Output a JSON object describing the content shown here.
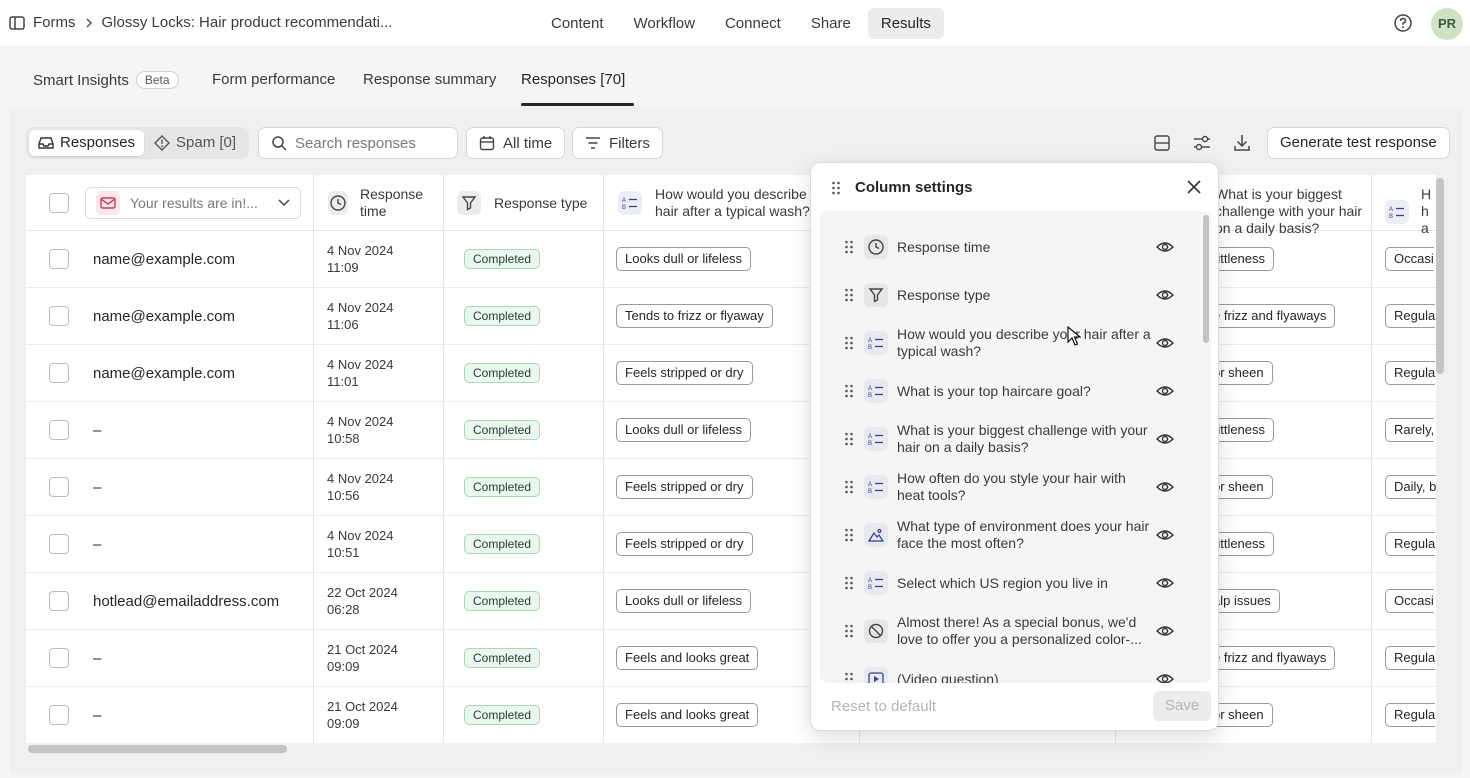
{
  "breadcrumb": {
    "root": "Forms",
    "current": "Glossy Locks: Hair product recommendati..."
  },
  "nav": [
    "Content",
    "Workflow",
    "Connect",
    "Share",
    "Results"
  ],
  "avatar": "PR",
  "subtabs": {
    "smart": "Smart Insights",
    "beta": "Beta",
    "performance": "Form performance",
    "summary": "Response summary",
    "responses": "Responses [70]"
  },
  "toolbar": {
    "responses": "Responses",
    "spam": "Spam [0]",
    "search_placeholder": "Search responses",
    "alltime": "All time",
    "filters": "Filters",
    "generate": "Generate test response"
  },
  "headers": {
    "email": "Your results are in!...",
    "time": "Response time",
    "type": "Response type",
    "q1": "How would you describe your hair after a typical wash?",
    "q3": "What is your biggest challenge with your hair on a daily basis?",
    "q4": "H ha"
  },
  "rows": [
    {
      "email": "name@example.com",
      "date": "4 Nov 2024",
      "time": "11:09",
      "status": "Completed",
      "wash": "Looks dull or lifeless",
      "challenge": "rittleness",
      "style": "Occasi"
    },
    {
      "email": "name@example.com",
      "date": "4 Nov 2024",
      "time": "11:06",
      "status": "Completed",
      "wash": "Tends to frizz or flyaway",
      "challenge": "e frizz and flyaways",
      "style": "Regula"
    },
    {
      "email": "name@example.com",
      "date": "4 Nov 2024",
      "time": "11:01",
      "status": "Completed",
      "wash": "Feels stripped or dry",
      "challenge": "or sheen",
      "style": "Regula"
    },
    {
      "email": "–",
      "date": "4 Nov 2024",
      "time": "10:58",
      "status": "Completed",
      "wash": "Looks dull or lifeless",
      "challenge": "rittleness",
      "style": "Rarely,"
    },
    {
      "email": "–",
      "date": "4 Nov 2024",
      "time": "10:56",
      "status": "Completed",
      "wash": "Feels stripped or dry",
      "challenge": "or sheen",
      "style": "Daily, b"
    },
    {
      "email": "–",
      "date": "4 Nov 2024",
      "time": "10:51",
      "status": "Completed",
      "wash": "Feels stripped or dry",
      "challenge": "rittleness",
      "style": "Regula"
    },
    {
      "email": "hotlead@emailaddress.com",
      "date": "22 Oct 2024",
      "time": "06:28",
      "status": "Completed",
      "wash": "Looks dull or lifeless",
      "challenge": "alp issues",
      "style": "Occasi"
    },
    {
      "email": "–",
      "date": "21 Oct 2024",
      "time": "09:09",
      "status": "Completed",
      "wash": "Feels and looks great",
      "challenge": "e frizz and flyaways",
      "style": "Regula"
    },
    {
      "email": "–",
      "date": "21 Oct 2024",
      "time": "09:09",
      "status": "Completed",
      "wash": "Feels and looks great",
      "challenge": "or sheen",
      "style": "Regula"
    }
  ],
  "panel": {
    "title": "Column settings",
    "items": [
      "Response time",
      "Response type",
      "How would you describe your hair after a typical wash?",
      "What is your top haircare goal?",
      "What is your biggest challenge with your hair on a daily basis?",
      "How often do you style your hair with heat tools?",
      "What type of environment does your hair face the most often?",
      "Select which US region you live in",
      "Almost there! As a special bonus, we'd love to offer you a personalized color-...",
      "(Video question)"
    ],
    "reset": "Reset to default",
    "save": "Save"
  }
}
